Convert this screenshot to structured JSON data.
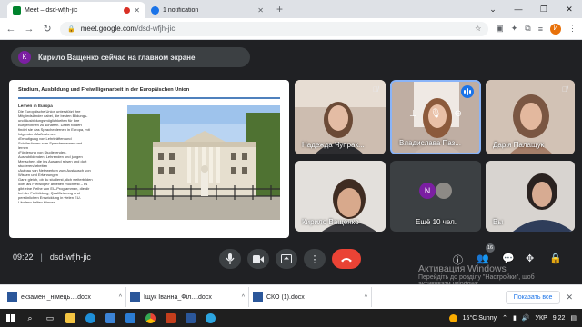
{
  "browser": {
    "tabs": [
      {
        "label": "Meet – dsd-wfjh-jic",
        "recording": true
      },
      {
        "label": "1 notification",
        "recording": false
      }
    ],
    "new_tab_icon": "+",
    "url_host": "meet.google.com",
    "url_path": "/dsd-wfjh-jic",
    "profile_initial": "И"
  },
  "banner": {
    "avatar_initial": "K",
    "text": "Кирило Ващенко сейчас на главном экране",
    "avatar_color": "#7b1fa2"
  },
  "slide": {
    "title": "Studium, Ausbildung und Freiwilligenarbeit in der Europäischen Union",
    "subheading": "Lernen in Europa",
    "body_lines": [
      "Die Europäische Union unterstützt ihre",
      "Mitgliedsländer dabei, die besten Bildungs-",
      "und Ausbildungsmöglichkeiten für ihre",
      "Bürger/innen zu schaffen. Dabei fördert",
      "findet sie das Sprachenlernen in Europa, mit",
      "folgenden Maßnahmen:",
      "•Ermutigung von Lehrkräften und",
      "Schüler/innen zum Sprachenlernen und -",
      "lernen",
      "•Förderung von Studierenden,",
      "Auszubildenden, Lehrenden und jungen",
      "Menschen, die ins Ausland reisen und dort",
      "studieren/arbeiten",
      "•Aufbau von Netzwerken zum Austausch von",
      "Wissen und Erfahrungen",
      "Ganz gleich, ob du studierst, dich weiterbilden",
      "oder als Freiwilige/r arbeiten möchtest – es",
      "gibt eine Reihe von EU-Programmen, die dir",
      "bei der Fortbildung, Qualifizierung und",
      "persönlichen Entwicklung in vielen EU-",
      "Ländern helfen können."
    ]
  },
  "participants": [
    {
      "name": "Надежда Чупрак...",
      "muted": true
    },
    {
      "name": "Владислава Паз...",
      "muted": false,
      "speaking": true
    },
    {
      "name": "Дарія Палащук",
      "muted": true
    },
    {
      "name": "Кирило Ващенко",
      "muted": false
    },
    {
      "name": "Ещё 10 чел.",
      "muted": false,
      "initial": "N"
    },
    {
      "name": "Вы",
      "muted": false
    }
  ],
  "meeting": {
    "time": "09:22",
    "separator": "|",
    "code": "dsd-wfjh-jic",
    "participant_count": "16"
  },
  "watermark": {
    "title": "Активация Windows",
    "subtitle_1": "Перейдіть до розділу \"Настройки\", щоб",
    "subtitle_2": "активувати Windows."
  },
  "downloads": {
    "items": [
      "екзамен _німець....docx",
      "Іщук Іванна_Філ....docx",
      "СКО (1).docx"
    ],
    "show_all": "Показать все"
  },
  "taskbar": {
    "weather": "15°C  Sunny",
    "language": "УКР",
    "clock": "9:22"
  },
  "colors": {
    "meet_bg": "#202124",
    "hangup": "#ea4335",
    "speaking": "#1a73e8"
  }
}
